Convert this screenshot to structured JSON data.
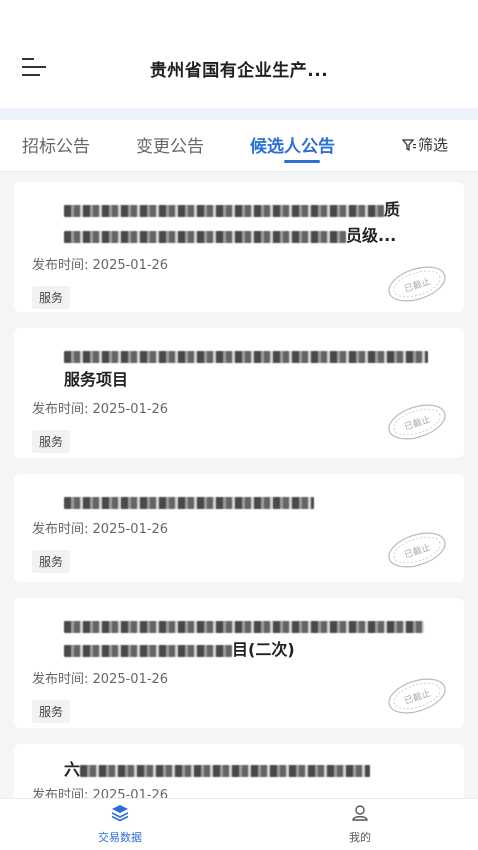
{
  "header": {
    "title": "贵州省国有企业生产..."
  },
  "tabs": [
    {
      "label": "招标公告",
      "active": false
    },
    {
      "label": "变更公告",
      "active": false
    },
    {
      "label": "候选人公告",
      "active": true
    }
  ],
  "filter": {
    "label": "筛选",
    "icon": "filter-icon"
  },
  "cards": [
    {
      "title_line1_tail": "质",
      "title_line2_tail": "员级...",
      "date_label": "发布时间:",
      "date": "2025-01-26",
      "tag": "服务",
      "stamp": "已截止"
    },
    {
      "title_line2": "服务项目",
      "date_label": "发布时间:",
      "date": "2025-01-26",
      "tag": "服务",
      "stamp": "已截止"
    },
    {
      "date_label": "发布时间:",
      "date": "2025-01-26",
      "tag": "服务",
      "stamp": "已截止"
    },
    {
      "title_line2_tail": "目(二次)",
      "date_label": "发布时间:",
      "date": "2025-01-26",
      "tag": "服务",
      "stamp": "已截止"
    },
    {
      "title_line1_head": "六",
      "date_label": "发布时间:",
      "date": "2025-01-26"
    }
  ],
  "bottom_nav": [
    {
      "label": "交易数据",
      "icon": "layers-icon",
      "active": true
    },
    {
      "label": "我的",
      "icon": "user-icon",
      "active": false
    }
  ],
  "colors": {
    "accent": "#2d6fd8",
    "background": "#f4f5f7"
  }
}
